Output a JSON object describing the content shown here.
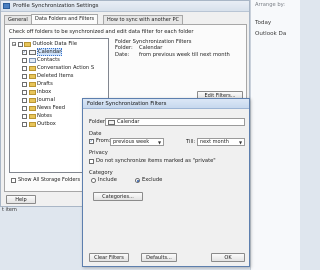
{
  "background_app": {
    "title": "Arrange by:",
    "label_today": "Today",
    "label_outlook": "Outlook Da"
  },
  "window": {
    "title": "Profile Synchronization Settings",
    "tabs": [
      {
        "label": "General"
      },
      {
        "label": "Data Folders and Filters"
      },
      {
        "label": "How to sync with another PC"
      }
    ],
    "instructions": "Check off folders to be synchronized and edit data filter for each folder",
    "tree": [
      {
        "label": "Outlook Data File",
        "checked": false
      },
      {
        "label": "Calendar",
        "checked": true
      },
      {
        "label": "Contacts",
        "checked": false
      },
      {
        "label": "Conversation Action S",
        "checked": false
      },
      {
        "label": "Deleted Items",
        "checked": false
      },
      {
        "label": "Drafts",
        "checked": false
      },
      {
        "label": "Inbox",
        "checked": false
      },
      {
        "label": "Journal",
        "checked": false
      },
      {
        "label": "News Feed",
        "checked": false
      },
      {
        "label": "Notes",
        "checked": false
      },
      {
        "label": "Outbox",
        "checked": false
      }
    ],
    "filter_info": {
      "heading": "Folder Synchronization Filters",
      "folder_key": "Folder:",
      "folder_value": "Calendar",
      "date_key": "Date:",
      "date_value": "from previous week till next month"
    },
    "edit_filters_label": "Edit Filters...",
    "show_all_label": "Show All Storage Folders",
    "help_label": "Help",
    "cut_off_label": "t item"
  },
  "dialog": {
    "title": "Folder Synchronization Filters",
    "folder_label": "Folder",
    "folder_value": "Calendar",
    "date_heading": "Date",
    "from_label": "From:",
    "from_value": "previous week",
    "till_label": "Till:",
    "till_value": "next month",
    "privacy_heading": "Privacy",
    "private_label": "Do not synchronize items marked as \"private\"",
    "category_heading": "Category",
    "include_label": "Include",
    "exclude_label": "Exclude",
    "categories_btn": "Categories...",
    "clear_btn": "Clear Filters",
    "defaults_btn": "Defaults...",
    "ok_btn": "OK"
  },
  "colors": {
    "accent": "#3a73c9",
    "window_bg": "#f0f0f0",
    "desktop_bg": "#dfe6ee"
  }
}
